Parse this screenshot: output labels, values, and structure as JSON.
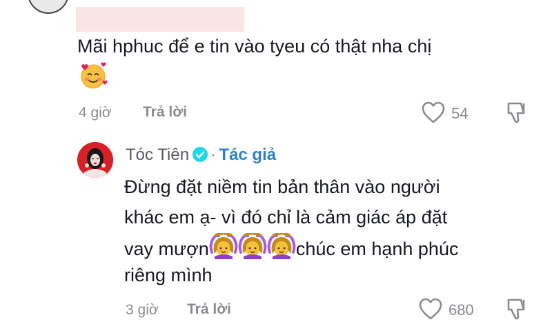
{
  "comment_top": {
    "text": "Mãi hphuc để e tin vào tyeu có thật nha chị",
    "emoji": "smiling-face-with-hearts",
    "time": "4 giờ",
    "reply_label": "Trả lời",
    "likes": "54"
  },
  "reply": {
    "author": "Tóc Tiên",
    "separator": "·",
    "author_tag": "Tác giả",
    "line1": "Đừng đặt niềm tin bản thân vào người",
    "line2": "khác em ạ- vì đó chỉ là cảm giác áp đặt",
    "line3_start": "vay mượn",
    "line3_end": "chúc em hạnh phúc",
    "line4": "riêng mình",
    "time": "3 giờ",
    "reply_label": "Trả lời",
    "likes": "680"
  },
  "colors": {
    "text": "#161823",
    "muted": "#8a8b91",
    "author_tag": "#2b83c6",
    "verified": "#20d5ec",
    "redaction": "#fde4e4"
  }
}
